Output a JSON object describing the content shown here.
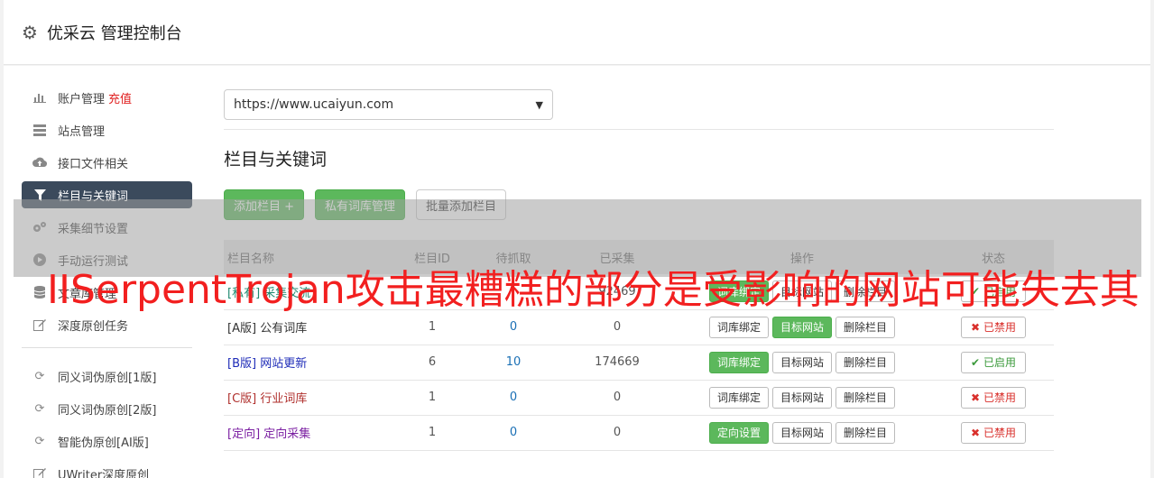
{
  "header": {
    "title": "优采云 管理控制台",
    "icon": "gear-icon"
  },
  "sidebar": {
    "account_label": "账户管理",
    "recharge_label": "充值",
    "items": [
      {
        "label": "站点管理",
        "icon": "server-icon"
      },
      {
        "label": "接口文件相关",
        "icon": "cloud-upload-icon"
      },
      {
        "label": "栏目与关键词",
        "icon": "filter-icon"
      },
      {
        "label": "采集细节设置",
        "icon": "cogs-icon"
      },
      {
        "label": "手动运行测试",
        "icon": "play-icon"
      },
      {
        "label": "文章库管理",
        "icon": "database-icon"
      },
      {
        "label": "深度原创任务",
        "icon": "edit-icon"
      }
    ],
    "items2": [
      {
        "label": "同义词伪原创[1版]",
        "icon": "refresh-icon"
      },
      {
        "label": "同义词伪原创[2版]",
        "icon": "refresh-icon"
      },
      {
        "label": "智能伪原创[AI版]",
        "icon": "refresh-icon"
      },
      {
        "label": "UWriter深度原创",
        "icon": "edit-icon"
      }
    ]
  },
  "site_select": {
    "value": "https://www.ucaiyun.com"
  },
  "section": {
    "title": "栏目与关键词"
  },
  "buttons": {
    "add": "添加栏目 +",
    "private_lib": "私有词库管理",
    "batch_add": "批量添加栏目"
  },
  "table": {
    "headers": [
      "栏目名称",
      "栏目ID",
      "待抓取",
      "已采集",
      "操作",
      "状态"
    ],
    "rows": [
      {
        "tag": "[私有]",
        "name": "采集交流",
        "id": "",
        "pending": "",
        "collected": "92469",
        "op1": "词库绑定",
        "op2": "目标网站",
        "op3": "删除栏目",
        "status": "已启用"
      },
      {
        "tag": "[A版]",
        "name": "公有词库",
        "id": "1",
        "pending": "0",
        "collected": "0",
        "op1": "词库绑定",
        "op2": "目标网站",
        "op3": "删除栏目",
        "status": "已禁用"
      },
      {
        "tag": "[B版]",
        "name": "网站更新",
        "id": "6",
        "pending": "10",
        "collected": "174669",
        "op1": "词库绑定",
        "op2": "目标网站",
        "op3": "删除栏目",
        "status": "已启用"
      },
      {
        "tag": "[C版]",
        "name": "行业词库",
        "id": "1",
        "pending": "0",
        "collected": "0",
        "op1": "词库绑定",
        "op2": "目标网站",
        "op3": "删除栏目",
        "status": "已禁用"
      },
      {
        "tag": "[定向]",
        "name": "定向采集",
        "id": "1",
        "pending": "0",
        "collected": "0",
        "op1": "定向设置",
        "op2": "目标网站",
        "op3": "删除栏目",
        "status": "已禁用"
      }
    ]
  },
  "overlay": {
    "text": "IISerpentTrojan攻击最糟糕的部分是受影响的网站可能失去其"
  },
  "colors": {
    "accent_green": "#5cb85c",
    "sidebar_active": "#3b4a5c",
    "overlay_red": "#f21f1f"
  }
}
